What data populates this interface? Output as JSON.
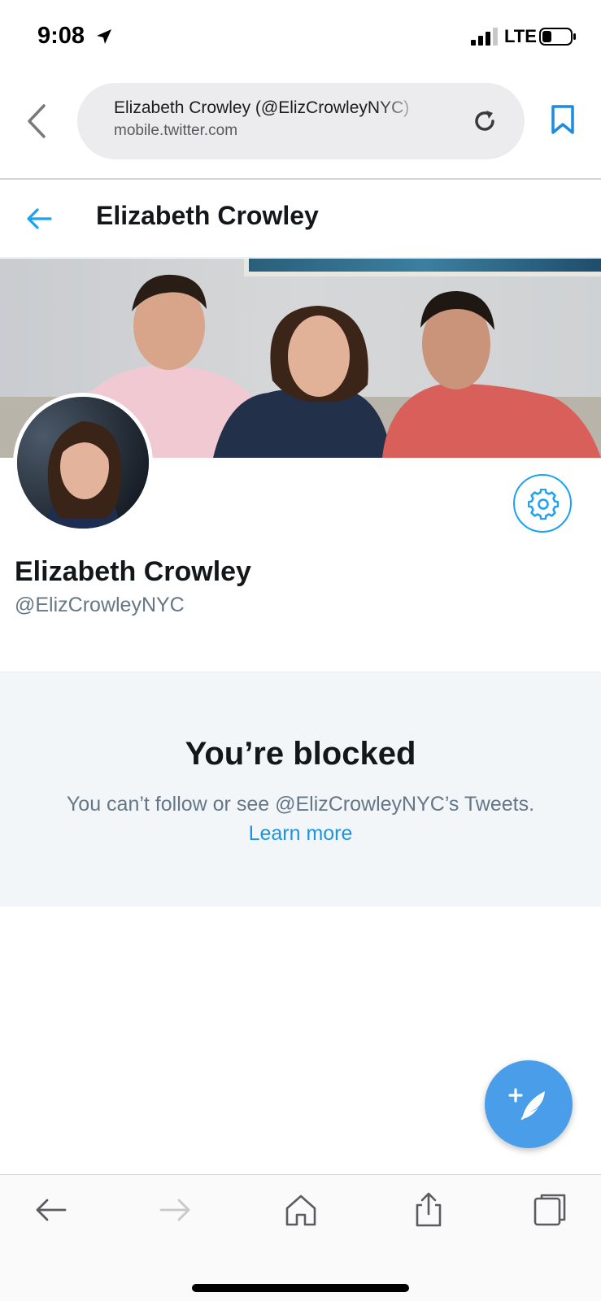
{
  "status_bar": {
    "time": "9:08",
    "network": "LTE",
    "icons": [
      "location-arrow-icon",
      "signal-bars-icon",
      "battery-icon"
    ]
  },
  "browser": {
    "page_title": "Elizabeth Crowley (@ElizCrowleyNYC)",
    "host": "mobile.twitter.com",
    "icons": [
      "chevron-left-icon",
      "reload-icon",
      "bookmark-icon"
    ]
  },
  "header": {
    "title": "Elizabeth Crowley",
    "icons": [
      "arrow-left-icon"
    ]
  },
  "profile": {
    "name": "Elizabeth Crowley",
    "handle": "@ElizCrowleyNYC",
    "icons": [
      "gear-icon"
    ]
  },
  "blocked": {
    "title": "You’re blocked",
    "message": "You can’t follow or see @ElizCrowleyNYC’s Tweets.",
    "link": "Learn more"
  },
  "compose": {
    "icons": [
      "compose-tweet-icon"
    ]
  },
  "toolbar": {
    "icons": [
      "back-arrow-icon",
      "forward-arrow-icon",
      "home-icon",
      "share-icon",
      "tabs-icon"
    ]
  },
  "colors": {
    "accent": "#1da1f2",
    "link": "#1b95e0",
    "fab": "#4a9ee9",
    "panel_bg": "#f3f6f9",
    "secondary_text": "#657786"
  }
}
